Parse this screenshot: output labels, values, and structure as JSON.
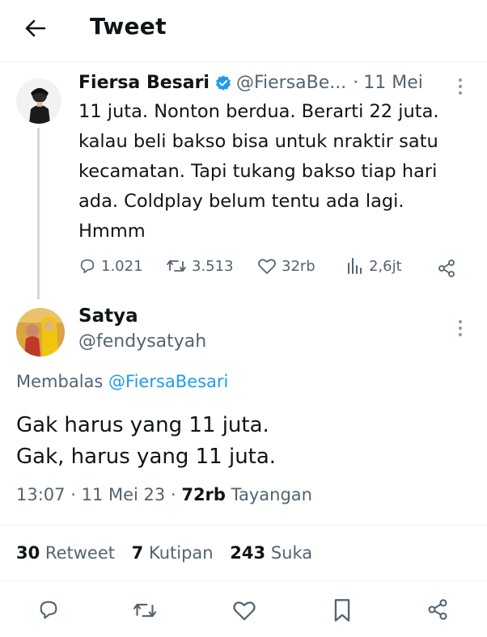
{
  "header": {
    "title": "Tweet"
  },
  "parent_tweet": {
    "author_name": "Fiersa Besari",
    "handle": "@FiersaBe...",
    "separator": "·",
    "date": "11 Mei",
    "text_lines": [
      "11 juta. Nonton berdua. Berarti 22 juta.",
      "kalau beli bakso bisa untuk nraktir satu",
      "kecamatan. Tapi tukang bakso tiap hari",
      "ada. Coldplay belum tentu ada lagi.",
      "Hmmm"
    ],
    "replies": "1.021",
    "retweets": "3.513",
    "likes": "32rb",
    "views": "2,6jt"
  },
  "reply_tweet": {
    "author_name": "Satya",
    "handle": "@fendysatyah",
    "replying_prefix": "Membalas",
    "replying_to": "@FiersaBesari",
    "text_lines": [
      "Gak harus yang 11 juta.",
      "Gak, harus yang 11 juta."
    ],
    "time": "13:07",
    "sep1": "·",
    "date": "11 Mei 23",
    "sep2": "·",
    "views_count": "72rb",
    "views_label": "Tayangan"
  },
  "engagement": {
    "retweets_count": "30",
    "retweets_label": "Retweet",
    "quotes_count": "7",
    "quotes_label": "Kutipan",
    "likes_count": "243",
    "likes_label": "Suka"
  },
  "colors": {
    "text": "#0f1419",
    "muted": "#536471",
    "accent": "#1d9bf0",
    "divider": "#eff3f4"
  },
  "icons": [
    "back-arrow-icon",
    "verified-badge-icon",
    "more-icon",
    "reply-icon",
    "retweet-icon",
    "like-icon",
    "views-icon",
    "share-icon",
    "bookmark-icon"
  ]
}
